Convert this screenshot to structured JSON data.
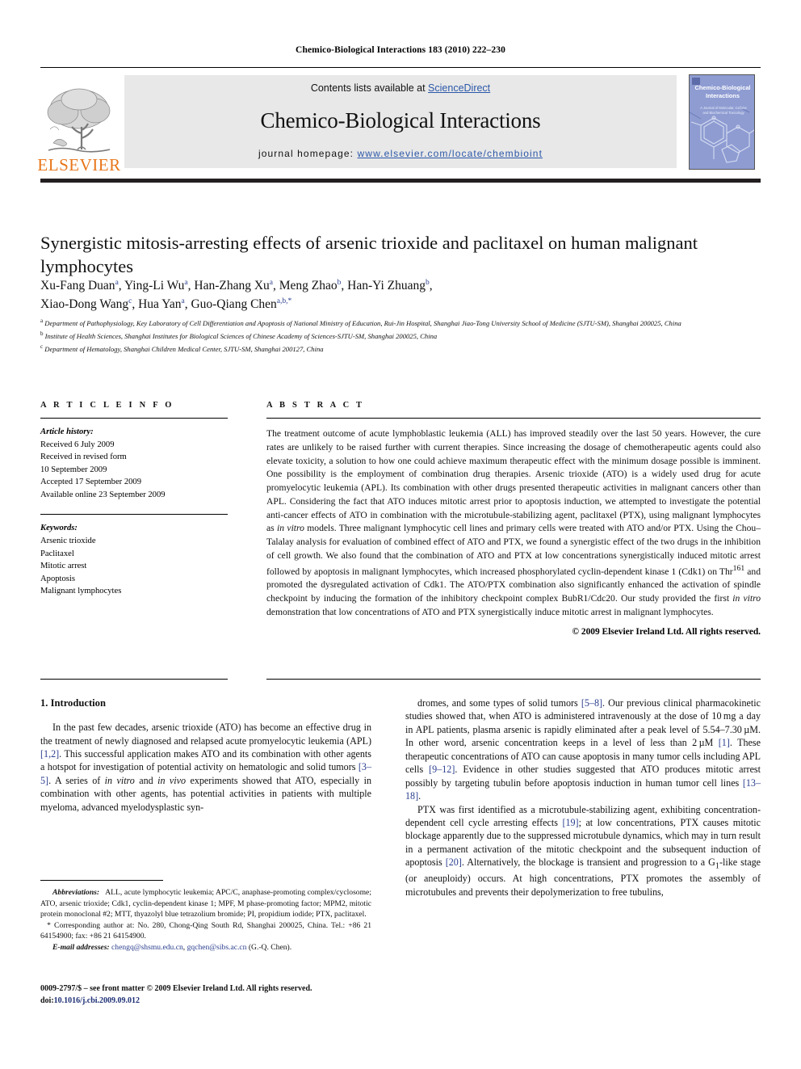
{
  "running_head": "Chemico-Biological Interactions 183 (2010) 222–230",
  "masthead": {
    "publisher_logo_label": "ELSEVIER",
    "contents_prefix": "Contents lists available at ",
    "contents_link": "ScienceDirect",
    "journal_name": "Chemico-Biological Interactions",
    "homepage_prefix": "journal homepage: ",
    "homepage_url": "www.elsevier.com/locate/chembioint",
    "cover_title": "Chemico-Biological Interactions",
    "cover_subtitle": "A Journal of Molecular, Cellular and Biochemical Toxicology"
  },
  "article": {
    "title": "Synergistic mitosis-arresting effects of arsenic trioxide and paclitaxel on human malignant lymphocytes",
    "authors_line1": "Xu-Fang Duan<sup>a</sup>, Ying-Li Wu<sup>a</sup>, Han-Zhang Xu<sup>a</sup>, Meng Zhao<sup>b</sup>, Han-Yi Zhuang<sup>b</sup>,",
    "authors_line2": "Xiao-Dong Wang<sup>c</sup>, Hua Yan<sup>a</sup>, Guo-Qiang Chen<sup>a,b,</sup><sup>*</sup>",
    "affiliations": [
      "<sup>a</sup> Department of Pathophysiology, Key Laboratory of Cell Differentiation and Apoptosis of National Ministry of Education, Rui-Jin Hospital, Shanghai Jiao-Tong University School of Medicine (SJTU-SM), Shanghai 200025, China",
      "<sup>b</sup> Institute of Health Sciences, Shanghai Institutes for Biological Sciences of Chinese Academy of Sciences-SJTU-SM, Shanghai 200025, China",
      "<sup>c</sup> Department of Hematology, Shanghai Children Medical Center, SJTU-SM, Shanghai 200127, China"
    ]
  },
  "article_info": {
    "heading": "A R T I C L E   I N F O",
    "history_label": "Article history:",
    "history": [
      "Received 6 July 2009",
      "Received in revised form",
      "10 September 2009",
      "Accepted 17 September 2009",
      "Available online 23 September 2009"
    ],
    "keywords_label": "Keywords:",
    "keywords": [
      "Arsenic trioxide",
      "Paclitaxel",
      "Mitotic arrest",
      "Apoptosis",
      "Malignant lymphocytes"
    ]
  },
  "abstract": {
    "heading": "A B S T R A C T",
    "text": "The treatment outcome of acute lymphoblastic leukemia (ALL) has improved steadily over the last 50 years. However, the cure rates are unlikely to be raised further with current therapies. Since increasing the dosage of chemotherapeutic agents could also elevate toxicity, a solution to how one could achieve maximum therapeutic effect with the minimum dosage possible is imminent. One possibility is the employment of combination drug therapies. Arsenic trioxide (ATO) is a widely used drug for acute promyelocytic leukemia (APL). Its combination with other drugs presented therapeutic activities in malignant cancers other than APL. Considering the fact that ATO induces mitotic arrest prior to apoptosis induction, we attempted to investigate the potential anti-cancer effects of ATO in combination with the microtubule-stabilizing agent, paclitaxel (PTX), using malignant lymphocytes as <span class=\"it\">in vitro</span> models. Three malignant lymphocytic cell lines and primary cells were treated with ATO and/or PTX. Using the Chou–Talalay analysis for evaluation of combined effect of ATO and PTX, we found a synergistic effect of the two drugs in the inhibition of cell growth. We also found that the combination of ATO and PTX at low concentrations synergistically induced mitotic arrest followed by apoptosis in malignant lymphocytes, which increased phosphorylated cyclin-dependent kinase 1 (Cdk1) on Thr<sup>161</sup> and promoted the dysregulated activation of Cdk1. The ATO/PTX combination also significantly enhanced the activation of spindle checkpoint by inducing the formation of the inhibitory checkpoint complex BubR1/Cdc20. Our study provided the first <span class=\"it\">in vitro</span> demonstration that low concentrations of ATO and PTX synergistically induce mitotic arrest in malignant lymphocytes.",
    "copyright": "© 2009 Elsevier Ireland Ltd. All rights reserved."
  },
  "body": {
    "section_heading": "1. Introduction",
    "left_paragraph": "In the past few decades, arsenic trioxide (ATO) has become an effective drug in the treatment of newly diagnosed and relapsed acute promyelocytic leukemia (APL) <span class=\"ref\">[1,2]</span>. This successful application makes ATO and its combination with other agents a hotspot for investigation of potential activity on hematologic and solid tumors <span class=\"ref\">[3–5]</span>. A series of <span class=\"it\">in vitro</span> and <span class=\"it\">in vivo</span> experiments showed that ATO, especially in combination with other agents, has potential activities in patients with multiple myeloma, advanced myelodysplastic syn-",
    "right_paragraph_1": "dromes, and some types of solid tumors <span class=\"ref\">[5–8]</span>. Our previous clinical pharmacokinetic studies showed that, when ATO is administered intravenously at the dose of 10 mg a day in APL patients, plasma arsenic is rapidly eliminated after a peak level of 5.54–7.30 µM. In other word, arsenic concentration keeps in a level of less than 2 µM <span class=\"ref\">[1]</span>. These therapeutic concentrations of ATO can cause apoptosis in many tumor cells including APL cells <span class=\"ref\">[9–12]</span>. Evidence in other studies suggested that ATO produces mitotic arrest possibly by targeting tubulin before apoptosis induction in human tumor cell lines <span class=\"ref\">[13–18]</span>.",
    "right_paragraph_2": "PTX was first identified as a microtubule-stabilizing agent, exhibiting concentration-dependent cell cycle arresting effects <span class=\"ref\">[19]</span>; at low concentrations, PTX causes mitotic blockage apparently due to the suppressed microtubule dynamics, which may in turn result in a permanent activation of the mitotic checkpoint and the subsequent induction of apoptosis <span class=\"ref\">[20]</span>. Alternatively, the blockage is transient and progression to a G<sub>1</sub>-like stage (or aneuploidy) occurs. At high concentrations, PTX promotes the assembly of microtubules and prevents their depolymerization to free tubulins,"
  },
  "footnotes": {
    "abbreviations": "<span class=\"ital\">Abbreviations:</span>&nbsp;&nbsp; ALL, acute lymphocytic leukemia; APC/C, anaphase-promoting complex/cyclosome; ATO, arsenic trioxide; Cdk1, cyclin-dependent kinase 1; MPF, M phase-promoting factor; MPM2, mitotic protein monoclonal #2; MTT, thyazolyl blue tetrazolium bromide; PI, propidium iodide; PTX, paclitaxel.",
    "corresponding": "&nbsp;&nbsp;* Corresponding author at: No. 280, Chong-Qing South Rd, Shanghai 200025, China. Tel.: +86 21 64154900; fax: +86 21 64154900.",
    "email": "<span class=\"ital\">E-mail addresses:</span> <span class=\"mail\">chengq@shsmu.edu.cn</span>, <span class=\"mail\">gqchen@sibs.ac.cn</span> (G.-Q. Chen)."
  },
  "imprint": {
    "line1": "0009-2797/$ – see front matter © 2009 Elsevier Ireland Ltd. All rights reserved.",
    "doi_prefix": "doi:",
    "doi": "10.1016/j.cbi.2009.09.012"
  },
  "colors": {
    "link_blue": "#2b57a8",
    "ref_blue": "#2b3f8f",
    "elsevier_orange": "#E8761A",
    "banner_gray": "#e8e8e8",
    "rule_black": "#231f20",
    "cover_blue": "#8e9cd2"
  }
}
